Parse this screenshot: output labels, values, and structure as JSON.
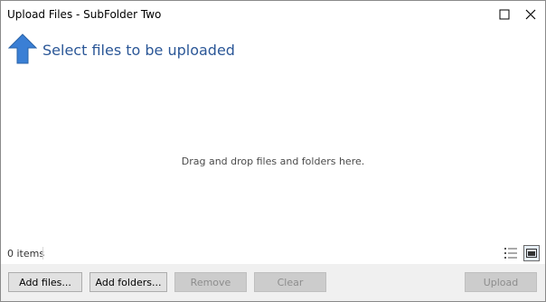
{
  "window": {
    "title": "Upload Files - SubFolder Two"
  },
  "header": {
    "title": "Select files to be uploaded",
    "icon": "up-arrow-icon",
    "accent_color": "#3a7fd5"
  },
  "dropzone": {
    "hint": "Drag and drop files and folders here."
  },
  "status": {
    "item_count": "0 items"
  },
  "buttons": {
    "add_files": "Add files...",
    "add_folders": "Add folders...",
    "remove": "Remove",
    "clear": "Clear",
    "upload": "Upload"
  }
}
